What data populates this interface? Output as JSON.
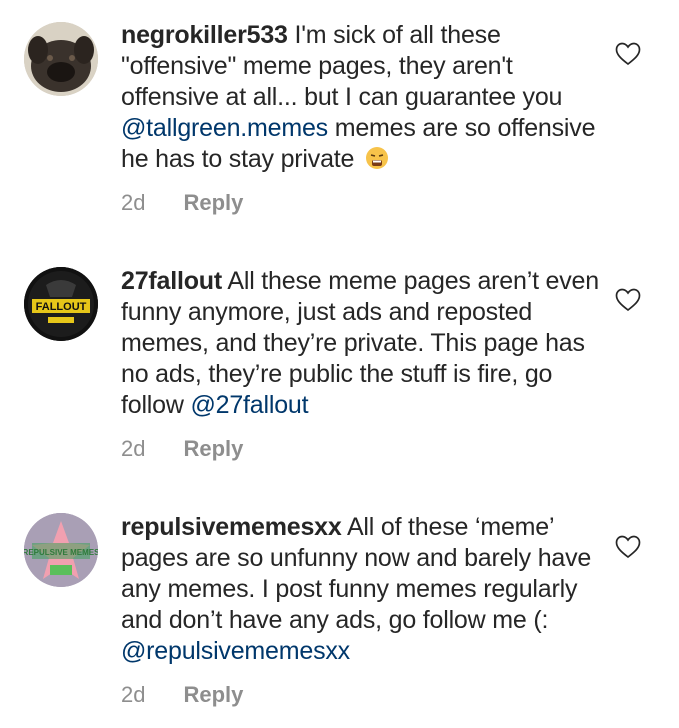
{
  "comments": [
    {
      "username": "negrokiller533",
      "text_before": "I'm sick of all these \"offensive\" meme pages, they aren't offensive at all... but I can guarantee you ",
      "mention": "@tallgreen.memes",
      "text_after": " memes are so offensive he has to stay private",
      "emoji": "tired-face-emoji",
      "time": "2d",
      "reply_label": "Reply",
      "avatar_icon": "dog-avatar"
    },
    {
      "username": "27fallout",
      "text_before": "All these meme pages aren’t even funny anymore, just ads and reposted memes, and they’re private. This page has no ads, they’re public the stuff is fire, go follow ",
      "mention": "@27fallout",
      "text_after": "",
      "time": "2d",
      "reply_label": "Reply",
      "avatar_icon": "fallout-logo-avatar",
      "avatar_text": "FALLOUT"
    },
    {
      "username": "repulsivememesxx",
      "text_before": "All of these ‘meme’ pages are so unfunny now and barely have any memes. I post funny memes regularly and don’t have any ads, go follow me (: ",
      "mention": "@repulsivememesxx",
      "text_after": "",
      "time": "2d",
      "reply_label": "Reply",
      "avatar_icon": "patrick-star-avatar",
      "avatar_text": "REPULSIVE MEMES"
    }
  ],
  "colors": {
    "text": "#262626",
    "meta": "#8e8e8e",
    "mention": "#00376b"
  },
  "icons": {
    "like": "heart-outline-icon"
  }
}
